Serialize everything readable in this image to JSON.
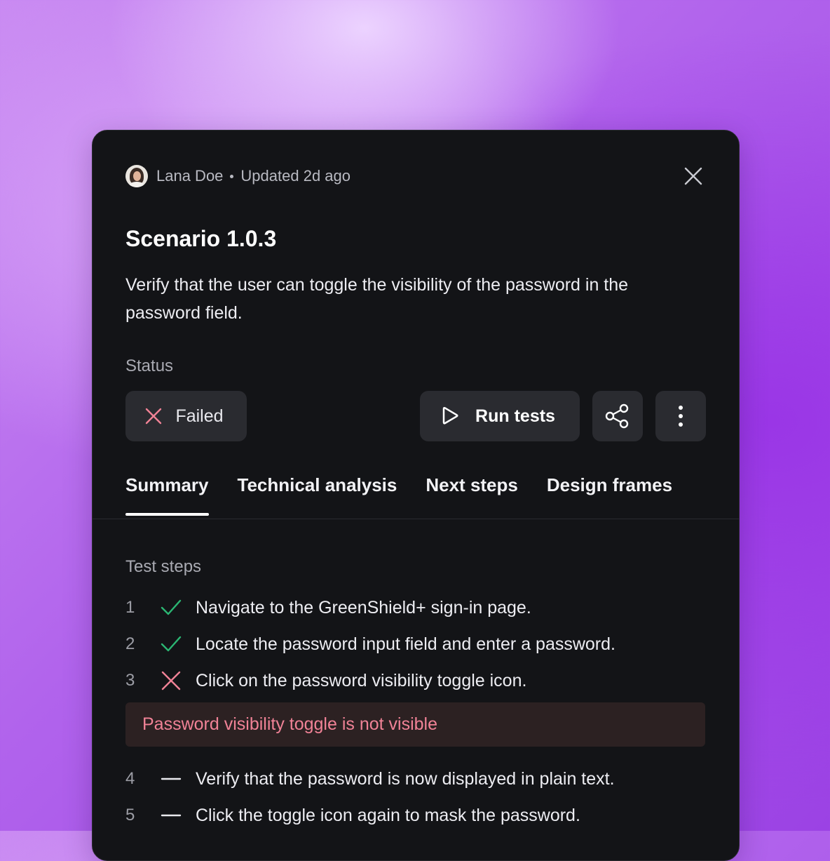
{
  "header": {
    "author": "Lana Doe",
    "updated": "Updated 2d ago"
  },
  "scenario": {
    "title": "Scenario 1.0.3",
    "description": "Verify that the user can toggle the visibility of the password in the password field."
  },
  "status": {
    "label": "Status",
    "value": "Failed",
    "color": "#f08296"
  },
  "actions": {
    "run_label": "Run tests",
    "share_icon": "share-icon",
    "more_icon": "more-vertical-icon"
  },
  "tabs": [
    {
      "label": "Summary",
      "active": true
    },
    {
      "label": "Technical analysis",
      "active": false
    },
    {
      "label": "Next steps",
      "active": false
    },
    {
      "label": "Design frames",
      "active": false
    }
  ],
  "test_steps": {
    "label": "Test steps",
    "items": [
      {
        "num": "1",
        "state": "passed",
        "text": "Navigate to the GreenShield+ sign-in page."
      },
      {
        "num": "2",
        "state": "passed",
        "text": "Locate the password input field and enter a password."
      },
      {
        "num": "3",
        "state": "failed",
        "text": "Click on the password visibility toggle icon."
      },
      {
        "num": "4",
        "state": "pending",
        "text": "Verify that the password is now displayed in plain text."
      },
      {
        "num": "5",
        "state": "pending",
        "text": "Click the toggle icon again to mask the password."
      }
    ],
    "error_message": "Password visibility toggle is not visible"
  },
  "colors": {
    "pass": "#2bb673",
    "fail": "#f08296",
    "card_bg": "#131417"
  }
}
